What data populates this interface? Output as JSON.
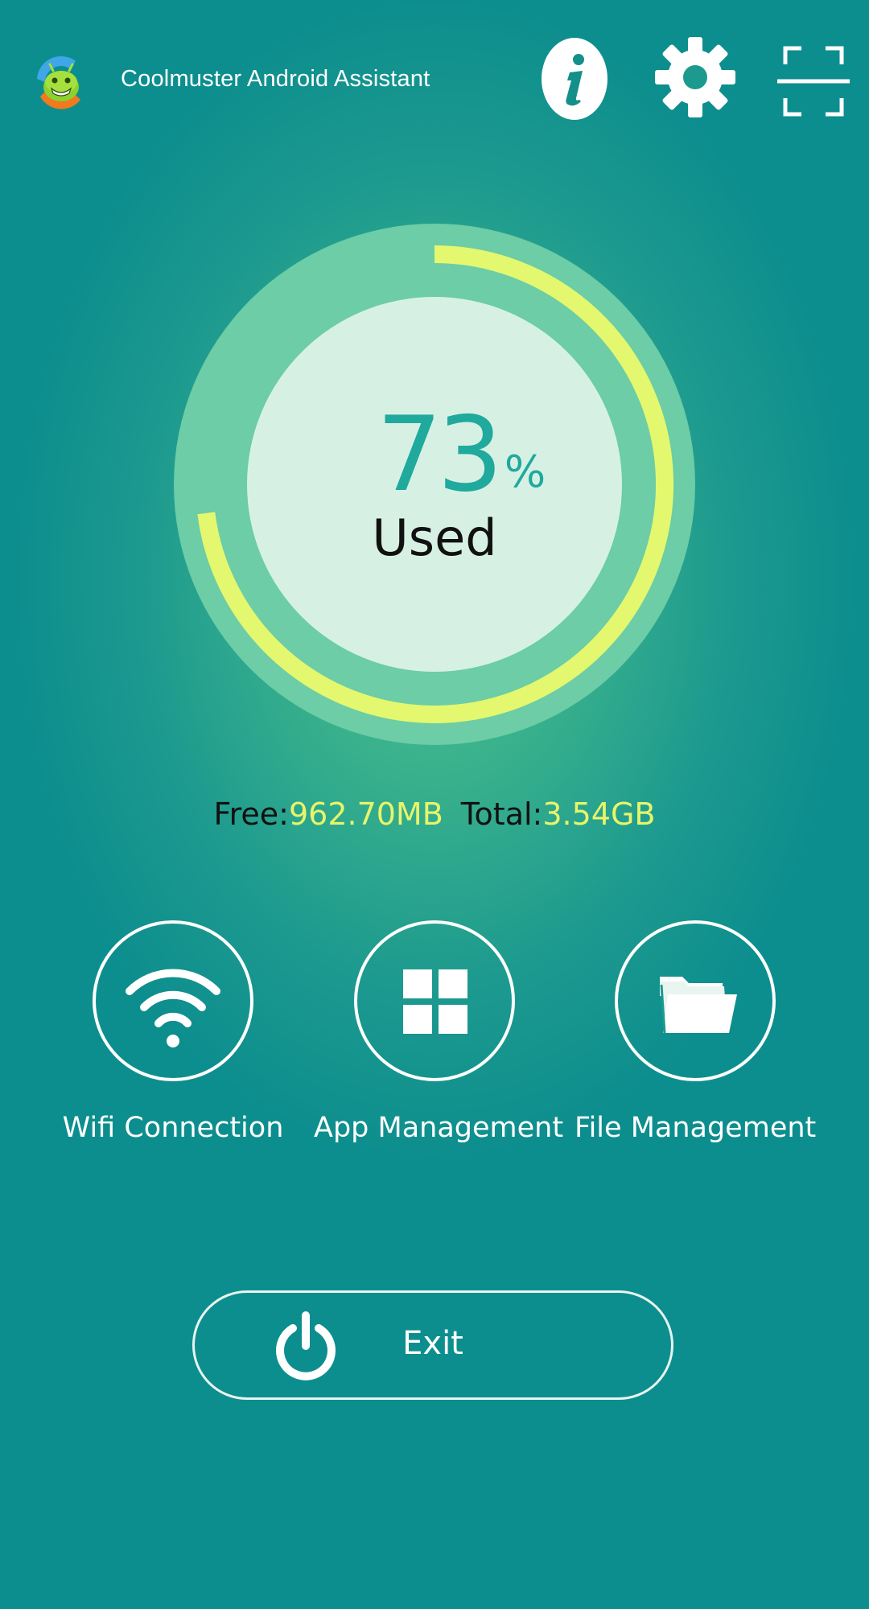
{
  "header": {
    "app_name": "Coolmuster Android Assistant",
    "logo_icon": "android-assistant-logo-icon",
    "actions": [
      {
        "name": "info",
        "icon": "info-icon"
      },
      {
        "name": "settings",
        "icon": "gear-icon"
      },
      {
        "name": "scan",
        "icon": "scan-frame-icon"
      }
    ]
  },
  "storage": {
    "used_percent": 73,
    "used_number": "73",
    "percent_sign": "%",
    "used_label": "Used",
    "free_label": "Free:",
    "free_value": "962.70MB",
    "total_label": "Total:",
    "total_value": "3.54GB"
  },
  "features": [
    {
      "label": "Wifi Connection",
      "icon": "wifi-icon"
    },
    {
      "label": "App Management",
      "icon": "grid-apps-icon"
    },
    {
      "label": "File Management",
      "icon": "folder-icon"
    }
  ],
  "exit": {
    "label": "Exit",
    "icon": "power-icon"
  },
  "colors": {
    "background": "#0d8e8e",
    "glow": "#4cc38a",
    "progress_arc": "#e3f86e",
    "gauge_inner": "#d6f1e4",
    "accent_text": "#20a99d",
    "value_text": "#e8f56a"
  }
}
